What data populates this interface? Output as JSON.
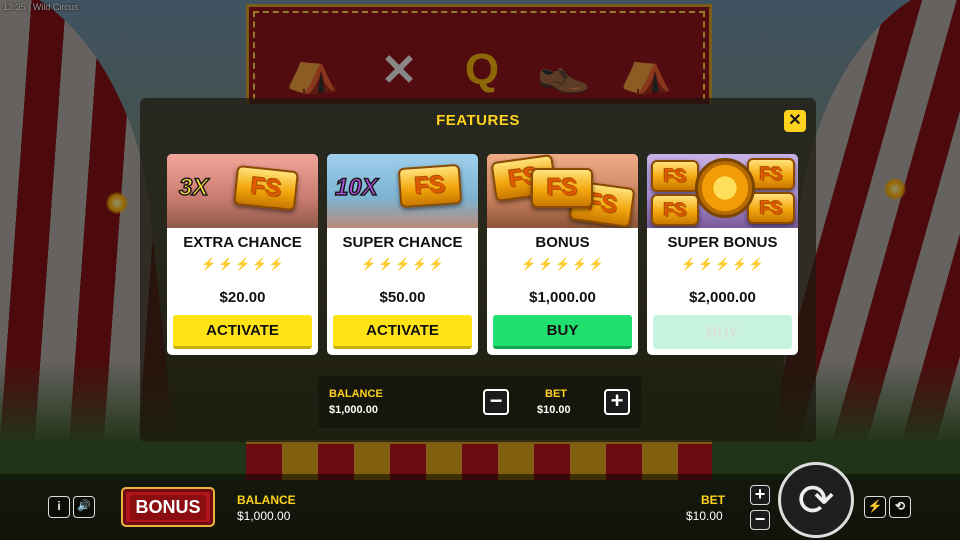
{
  "status_bar": {
    "time": "13:35",
    "separator": "|",
    "game_title": "Wild Circus"
  },
  "reel_symbols": [
    {
      "name": "tent-symbol-icon",
      "glyph": "⛺"
    },
    {
      "name": "juggling-pins-icon",
      "glyph": "✕"
    },
    {
      "name": "queen-symbol",
      "glyph": "Q"
    },
    {
      "name": "clown-shoes-icon",
      "glyph": "👞"
    },
    {
      "name": "tent-symbol-icon",
      "glyph": "⛺"
    }
  ],
  "modal": {
    "title": "FEATURES",
    "close_glyph": "✕",
    "cards": [
      {
        "name": "EXTRA CHANCE",
        "multiplier": "3X",
        "coin_text": "FS",
        "bolts_filled": 3,
        "bolts_total": 5,
        "price": "$20.00",
        "button": "ACTIVATE",
        "button_style": "yellow",
        "enabled": true
      },
      {
        "name": "SUPER CHANCE",
        "multiplier": "10X",
        "coin_text": "FS",
        "bolts_filled": 4,
        "bolts_total": 5,
        "price": "$50.00",
        "button": "ACTIVATE",
        "button_style": "yellow",
        "enabled": true
      },
      {
        "name": "BONUS",
        "multiplier": "",
        "coin_text": "FS",
        "bolts_filled": 4,
        "bolts_total": 5,
        "price": "$1,000.00",
        "button": "BUY",
        "button_style": "green",
        "enabled": true
      },
      {
        "name": "SUPER BONUS",
        "multiplier": "",
        "coin_text": "FS",
        "bolts_filled": 4,
        "bolts_total": 5,
        "price": "$2,000.00",
        "button": "BUY",
        "button_style": "disabled",
        "enabled": false
      }
    ],
    "bet_panel": {
      "balance_label": "BALANCE",
      "balance_value": "$1,000.00",
      "bet_label": "BET",
      "bet_value": "$10.00",
      "minus_glyph": "−",
      "plus_glyph": "+"
    }
  },
  "bottom_bar": {
    "info_glyph": "i",
    "sound_glyph": "🔊",
    "bonus_label": "BONUS",
    "balance_label": "BALANCE",
    "balance_value": "$1,000.00",
    "bet_label": "BET",
    "bet_value": "$10.00",
    "plus_glyph": "+",
    "minus_glyph": "−",
    "spin_glyph": "⟳",
    "turbo_glyph": "⚡",
    "autoplay_glyph": "⟲"
  },
  "colors": {
    "accent_yellow": "#ffd21e",
    "buy_green": "#21e070",
    "frame_red": "#b1141a"
  }
}
